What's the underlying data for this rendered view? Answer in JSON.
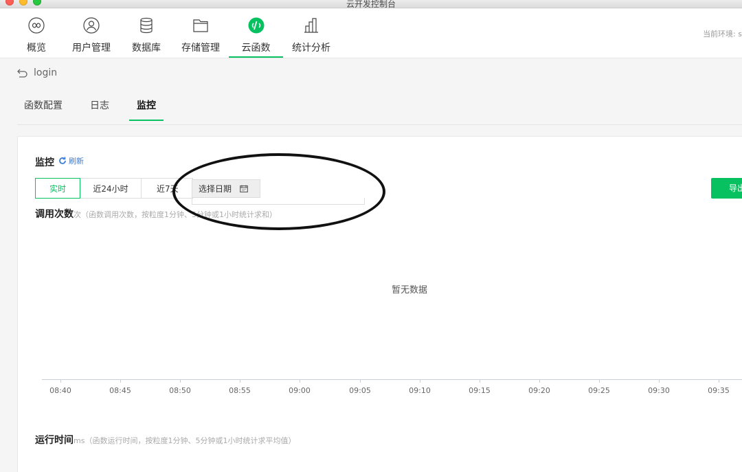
{
  "window": {
    "title": "云开发控制台"
  },
  "nav": {
    "items": [
      {
        "label": "概览",
        "icon": "infinity-icon"
      },
      {
        "label": "用户管理",
        "icon": "user-icon"
      },
      {
        "label": "数据库",
        "icon": "database-icon"
      },
      {
        "label": "存储管理",
        "icon": "folder-icon"
      },
      {
        "label": "云函数",
        "icon": "cloud-function-icon",
        "active": true
      },
      {
        "label": "统计分析",
        "icon": "bar-chart-icon"
      }
    ],
    "env_label": "当前环境: s"
  },
  "breadcrumb": {
    "back_label": "login"
  },
  "subtabs": [
    "函数配置",
    "日志",
    "监控"
  ],
  "monitor": {
    "title": "监控",
    "refresh_label": "刷新",
    "ranges": [
      "实时",
      "近24小时",
      "近7天"
    ],
    "date_picker": "选择日期",
    "export_label": "导出",
    "calls": {
      "title": "调用次数",
      "desc": "次（函数调用次数，按粒度1分钟、5分钟或1小时统计求和）"
    },
    "empty": "暂无数据",
    "x_ticks": [
      "08:40",
      "08:45",
      "08:50",
      "08:55",
      "09:00",
      "09:05",
      "09:10",
      "09:15",
      "09:20",
      "09:25",
      "09:30",
      "09:35"
    ],
    "runtime": {
      "title": "运行时间",
      "desc": "ms（函数运行时间，按粒度1分钟、5分钟或1小时统计求平均值）"
    }
  },
  "colors": {
    "accent": "#07c160",
    "link": "#3b7dd8"
  }
}
